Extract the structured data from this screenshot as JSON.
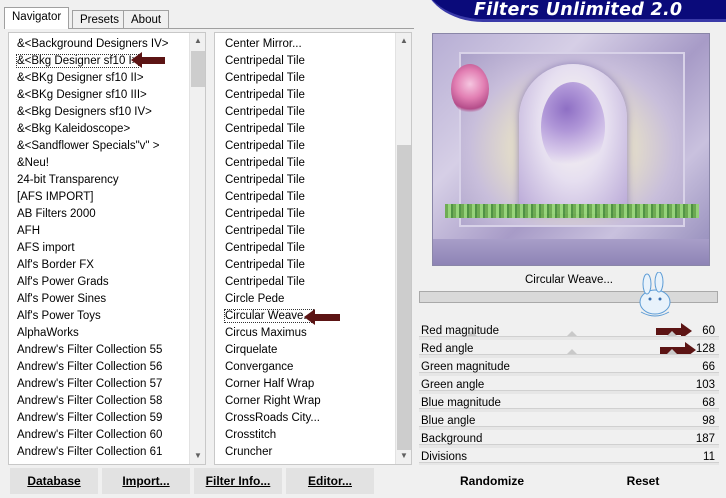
{
  "window": {
    "title": "Filters Unlimited 2.0"
  },
  "tabs": [
    {
      "label": "Navigator",
      "active": true
    },
    {
      "label": "Presets",
      "active": false
    },
    {
      "label": "About",
      "active": false
    }
  ],
  "categories": {
    "items": [
      "&<Background Designers IV>",
      "&<Bkg Designer sf10 I>",
      "&<BKg Designer sf10 II>",
      "&<BKg Designer sf10 III>",
      "&<Bkg Designers sf10 IV>",
      "&<Bkg Kaleidoscope>",
      "&<Sandflower Specials\"v\" >",
      "&Neu!",
      "24-bit Transparency",
      "[AFS IMPORT]",
      "AB Filters 2000",
      "AFH",
      "AFS import",
      "Alf's Border FX",
      "Alf's Power Grads",
      "Alf's Power Sines",
      "Alf's Power Toys",
      "AlphaWorks",
      "Andrew's Filter Collection 55",
      "Andrew's Filter Collection 56",
      "Andrew's Filter Collection 57",
      "Andrew's Filter Collection 58",
      "Andrew's Filter Collection 59",
      "Andrew's Filter Collection 60",
      "Andrew's Filter Collection 61"
    ],
    "selected_index": 1
  },
  "filters": {
    "items": [
      "Center Mirror...",
      "Centripedal Tile",
      "Centripedal Tile",
      "Centripedal Tile",
      "Centripedal Tile",
      "Centripedal Tile",
      "Centripedal Tile",
      "Centripedal Tile",
      "Centripedal Tile",
      "Centripedal Tile",
      "Centripedal Tile",
      "Centripedal Tile",
      "Centripedal Tile",
      "Centripedal Tile",
      "Centripedal Tile",
      "Circle Pede",
      "Circular Weave...",
      "Circus Maximus",
      "Cirquelate",
      "Convergance",
      "Corner Half Wrap",
      "Corner Right Wrap",
      "CrossRoads City...",
      "Crosstitch",
      "Cruncher"
    ],
    "selected_index": 16
  },
  "preview": {
    "filter_name": "Circular Weave..."
  },
  "params": [
    {
      "label": "Red magnitude",
      "value": "60"
    },
    {
      "label": "Red angle",
      "value": "128"
    },
    {
      "label": "Green magnitude",
      "value": "66"
    },
    {
      "label": "Green angle",
      "value": "103"
    },
    {
      "label": "Blue magnitude",
      "value": "68"
    },
    {
      "label": "Blue angle",
      "value": "98"
    },
    {
      "label": "Background",
      "value": "187"
    },
    {
      "label": "Divisions",
      "value": "11"
    }
  ],
  "buttons": {
    "database": "Database",
    "import": "Import...",
    "filter_info": "Filter Info...",
    "editor": "Editor...",
    "randomize": "Randomize",
    "reset": "Reset"
  },
  "colors": {
    "banner": "#0a0a7a",
    "marker_arrow": "#5c1414"
  },
  "icons": {
    "mascot": "bunny-watermark-icon",
    "marker": "arrow-marker-icon"
  }
}
